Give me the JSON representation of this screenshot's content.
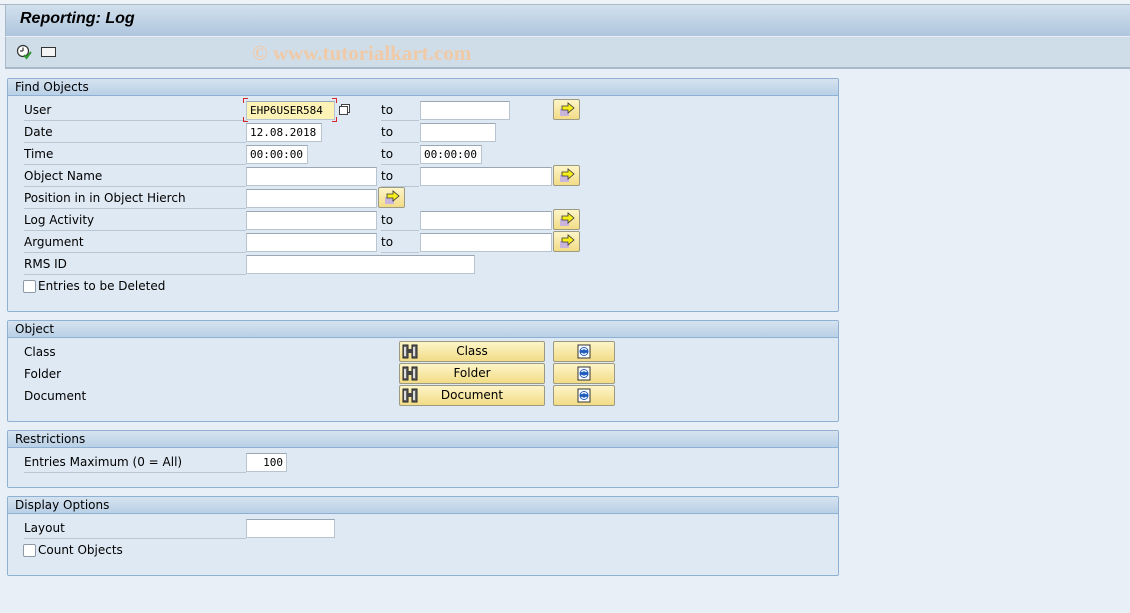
{
  "window": {
    "title": "Reporting: Log",
    "watermark": "© www.tutorialkart.com"
  },
  "toolbar": {
    "icons": [
      "execute-clock-icon",
      "variant-icon"
    ]
  },
  "find_objects": {
    "header": "Find Objects",
    "to_label": "to",
    "rows": [
      {
        "label": "User",
        "from": "EHP6USER584",
        "to": ""
      },
      {
        "label": "Date",
        "from": "12.08.2018",
        "to": ""
      },
      {
        "label": "Time",
        "from": "00:00:00",
        "to": "00:00:00"
      },
      {
        "label": "Object Name",
        "from": "",
        "to": ""
      },
      {
        "label": "Position in in Object Hierch",
        "from": ""
      },
      {
        "label": "Log Activity",
        "from": "",
        "to": ""
      },
      {
        "label": "Argument",
        "from": "",
        "to": ""
      },
      {
        "label": "RMS ID",
        "from": ""
      }
    ],
    "checkbox": {
      "label": "Entries to be Deleted",
      "checked": false
    }
  },
  "object": {
    "header": "Object",
    "rows": [
      {
        "label": "Class",
        "button": "Class"
      },
      {
        "label": "Folder",
        "button": "Folder"
      },
      {
        "label": "Document",
        "button": "Document"
      }
    ]
  },
  "restrictions": {
    "header": "Restrictions",
    "label": "Entries Maximum (0 = All)",
    "value": "100"
  },
  "display_options": {
    "header": "Display Options",
    "layout_label": "Layout",
    "layout_value": "",
    "checkbox": {
      "label": "Count Objects",
      "checked": false
    }
  }
}
